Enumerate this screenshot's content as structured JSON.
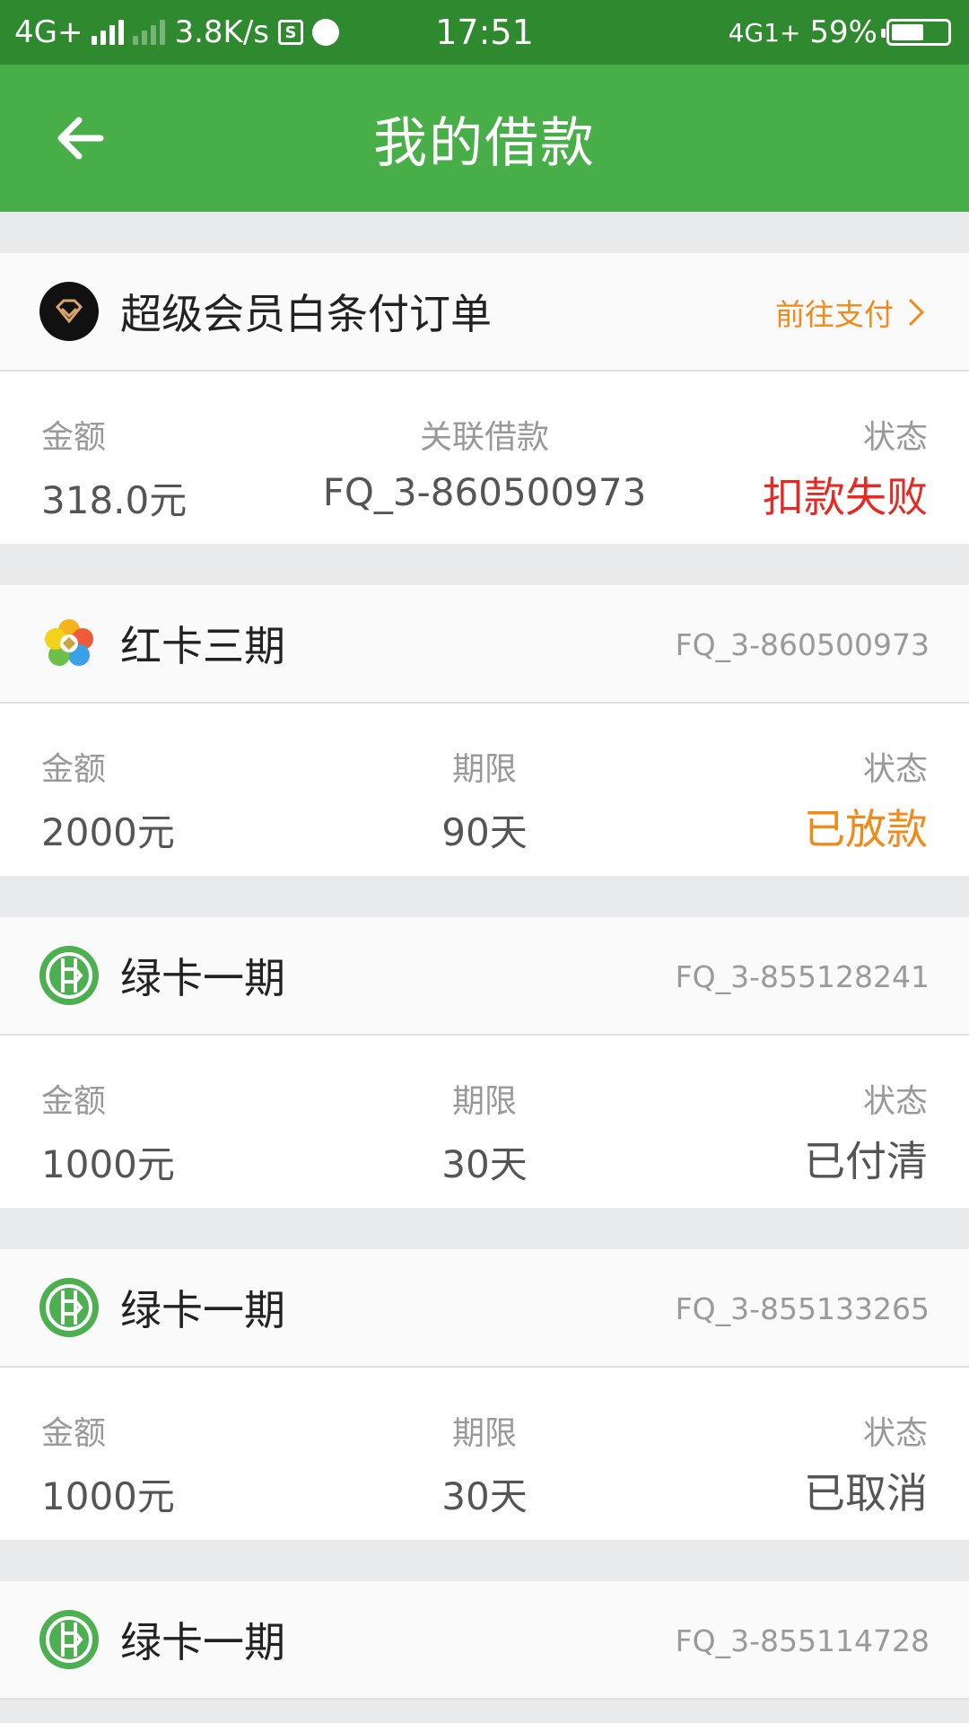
{
  "status_bar": {
    "network": "4G+",
    "speed": "3.8K/s",
    "time": "17:51",
    "network_right": "4G1+",
    "battery": "59%",
    "battery_level": 0.59
  },
  "appbar": {
    "title": "我的借款",
    "back_icon": "arrow-left-icon"
  },
  "colors": {
    "appbar": "#47ae48",
    "statusbar": "#2f8a2f",
    "red": "#e52a24",
    "orange": "#f08a18"
  },
  "cards": [
    {
      "icon": "diamond-icon",
      "name": "超级会员白条付订单",
      "right_text": "前往支付",
      "right_is_link": true,
      "cols": [
        {
          "label": "金额",
          "value": "318.0元"
        },
        {
          "label": "关联借款",
          "value": "FQ_3-860500973"
        },
        {
          "label": "状态",
          "value": "扣款失败",
          "status_color": "red"
        }
      ]
    },
    {
      "icon": "red-card-icon",
      "name": "红卡三期",
      "right_text": "FQ_3-860500973",
      "right_is_link": false,
      "cols": [
        {
          "label": "金额",
          "value": "2000元"
        },
        {
          "label": "期限",
          "value": "90天"
        },
        {
          "label": "状态",
          "value": "已放款",
          "status_color": "orange"
        }
      ]
    },
    {
      "icon": "green-card-icon",
      "name": "绿卡一期",
      "right_text": "FQ_3-855128241",
      "right_is_link": false,
      "cols": [
        {
          "label": "金额",
          "value": "1000元"
        },
        {
          "label": "期限",
          "value": "30天"
        },
        {
          "label": "状态",
          "value": "已付清",
          "status_color": "gray"
        }
      ]
    },
    {
      "icon": "green-card-icon",
      "name": "绿卡一期",
      "right_text": "FQ_3-855133265",
      "right_is_link": false,
      "cols": [
        {
          "label": "金额",
          "value": "1000元"
        },
        {
          "label": "期限",
          "value": "30天"
        },
        {
          "label": "状态",
          "value": "已取消",
          "status_color": "gray"
        }
      ]
    },
    {
      "icon": "green-card-icon",
      "name": "绿卡一期",
      "right_text": "FQ_3-855114728",
      "right_is_link": false,
      "cols": []
    }
  ]
}
